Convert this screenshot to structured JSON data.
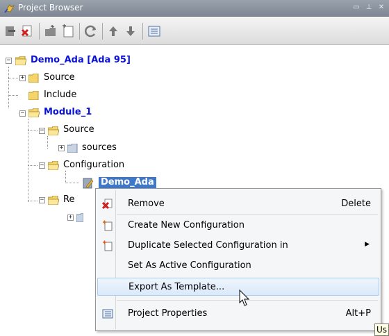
{
  "window": {
    "title": "Project Browser"
  },
  "colors": {
    "accent": "#0b12d8",
    "selection": "#3e78c9"
  },
  "toolbar": {
    "buttons": [
      "remove-icon",
      "delete-x-icon",
      "new-folder-icon",
      "new-config-icon",
      "refresh-icon",
      "move-up-icon",
      "move-down-icon",
      "properties-icon"
    ]
  },
  "tree": {
    "root": "Demo_Ada [Ada 95]",
    "source": "Source",
    "include": "Include",
    "module": "Module_1",
    "module_source": "Source",
    "sources": "sources",
    "configuration": "Configuration",
    "demo_ada": "Demo_Ada",
    "re_partial": "Re"
  },
  "menu": {
    "remove": {
      "label": "Remove",
      "shortcut": "Delete"
    },
    "create_config": {
      "label": "Create New Configuration"
    },
    "duplicate": {
      "label": "Duplicate Selected Configuration in"
    },
    "set_active": {
      "label": "Set As Active Configuration"
    },
    "export": {
      "label": "Export As Template..."
    },
    "properties": {
      "label": "Project Properties",
      "shortcut": "Alt+P"
    }
  },
  "tooltip": {
    "text": "Us"
  }
}
